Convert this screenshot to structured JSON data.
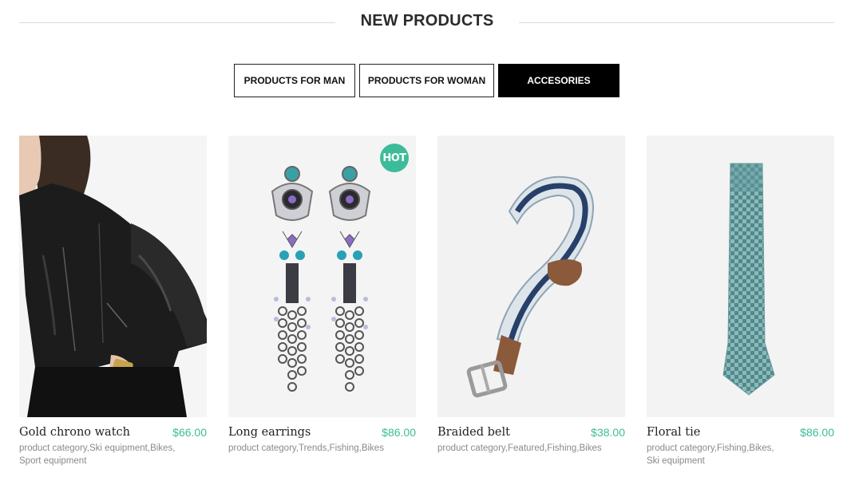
{
  "section": {
    "title": "NEW PRODUCTS"
  },
  "tabs": [
    {
      "label": "PRODUCTS FOR MAN",
      "active": false
    },
    {
      "label": "PRODUCTS FOR WOMAN",
      "active": false
    },
    {
      "label": "ACCESORIES",
      "active": true
    }
  ],
  "products": [
    {
      "name": "Gold chrono watch",
      "price": "$66.00",
      "categories_line1": "product category,Ski equipment,Bikes,",
      "categories_line2": "Sport equipment",
      "badge": "",
      "image": "woman-leather-jacket-photo"
    },
    {
      "name": "Long earrings",
      "price": "$86.00",
      "categories_line1": "product category,Trends,Fishing,Bikes",
      "categories_line2": "",
      "badge": "HOT",
      "image": "jeweled-earrings-photo"
    },
    {
      "name": "Braided belt",
      "price": "$38.00",
      "categories_line1": "product category,Featured,Fishing,Bikes",
      "categories_line2": "",
      "badge": "",
      "image": "braided-belt-photo"
    },
    {
      "name": "Floral tie",
      "price": "$86.00",
      "categories_line1": "product category,Fishing,Bikes,",
      "categories_line2": "Ski equipment",
      "badge": "",
      "image": "checkered-tie-photo"
    }
  ],
  "colors": {
    "accent": "#3cbc98",
    "active_tab_bg": "#000000",
    "text": "#222222",
    "muted": "#8a8a8a"
  }
}
